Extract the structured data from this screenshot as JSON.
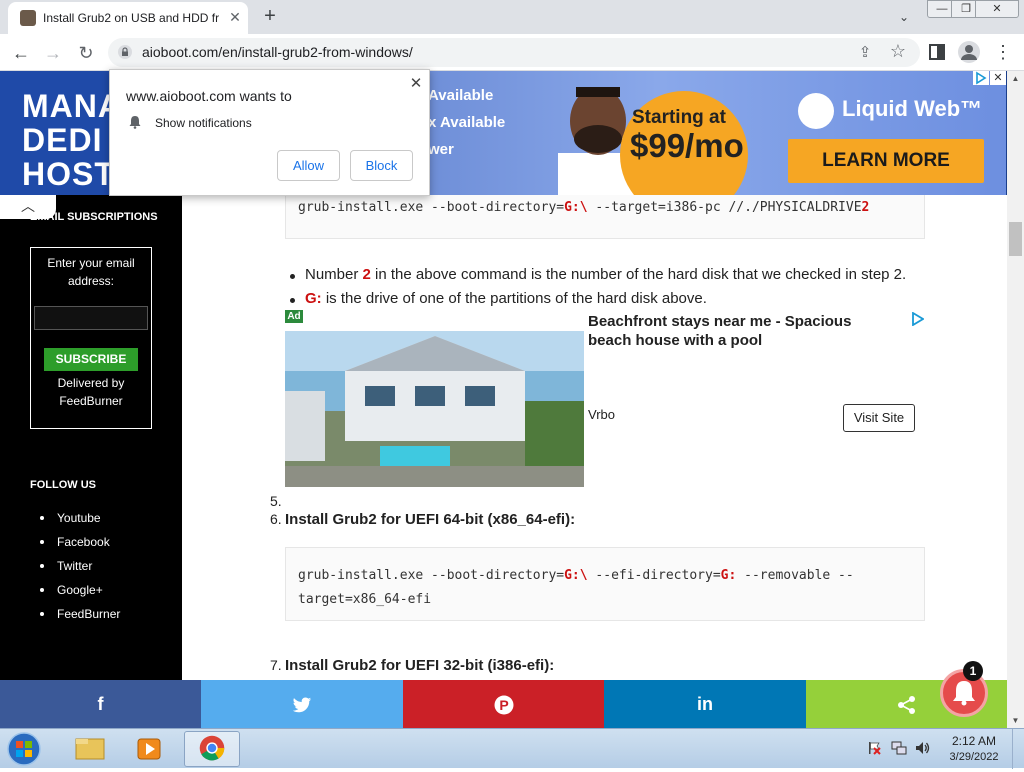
{
  "browser": {
    "tab_title": "Install Grub2 on USB and HDD fr",
    "url": "aioboot.com/en/install-grub2-from-windows/",
    "window_controls": {
      "minimize": "—",
      "maximize": "❐",
      "close": "✕"
    }
  },
  "banner_ad": {
    "left_text": "MANAG\nDEDI\nHOST",
    "available_1": "Available",
    "available_2": "x Available",
    "power": "wer",
    "price_line1": "Starting at",
    "price_line2": "$99/mo",
    "brand": "Liquid Web™",
    "cta": "LEARN MORE"
  },
  "notification": {
    "title": "www.aioboot.com wants to",
    "text": "Show notifications",
    "allow": "Allow",
    "block": "Block"
  },
  "sidebar": {
    "email_heading": "EMAIL SUBSCRIPTIONS",
    "email_prompt": "Enter your email address:",
    "subscribe": "SUBSCRIBE",
    "delivered_by": "Delivered by",
    "delivered_name": "FeedBurner",
    "follow_heading": "FOLLOW US",
    "social": [
      "Youtube",
      "Facebook",
      "Twitter",
      "Google+",
      "FeedBurner"
    ]
  },
  "content": {
    "code1": {
      "pre": "grub-install.exe --boot-directory=",
      "drive": "G:\\",
      "mid": " --target=i386-pc //./PHYSICALDRIVE",
      "num": "2"
    },
    "bullet1": {
      "pre": "Number ",
      "num": "2",
      "post": " in the above command is the number of the hard disk that we checked in step 2."
    },
    "bullet2": {
      "drive": "G:",
      "post": " is the drive of one of the partitions of the hard disk above."
    },
    "ad": {
      "badge": "Ad",
      "title": "Beachfront stays near me - Spacious beach house with a pool",
      "source": "Vrbo",
      "cta": "Visit Site"
    },
    "step5_num": "5.",
    "step6_num": "6.",
    "step6": "Install Grub2 for UEFI 64-bit (x86_64-efi):",
    "code2": {
      "pre": "grub-install.exe --boot-directory=",
      "drive1": "G:\\",
      "mid": " --efi-directory=",
      "drive2": "G:",
      "post": " --removable --",
      "line2": "target=x86_64-efi"
    },
    "step7_num": "7.",
    "step7": "Install Grub2 for UEFI 32-bit (i386-efi):"
  },
  "share_bar": {
    "facebook": "f",
    "twitter": "🐦",
    "pinterest": "P",
    "linkedin": "in",
    "share": "⋖"
  },
  "bell_badge": "1",
  "taskbar": {
    "time": "2:12 AM",
    "date": "3/29/2022"
  },
  "colors": {
    "accent_red": "#cc1111",
    "facebook": "#3b5998",
    "twitter": "#55acee",
    "pinterest": "#cb2027",
    "linkedin": "#0077b5",
    "share": "#95d03a"
  }
}
